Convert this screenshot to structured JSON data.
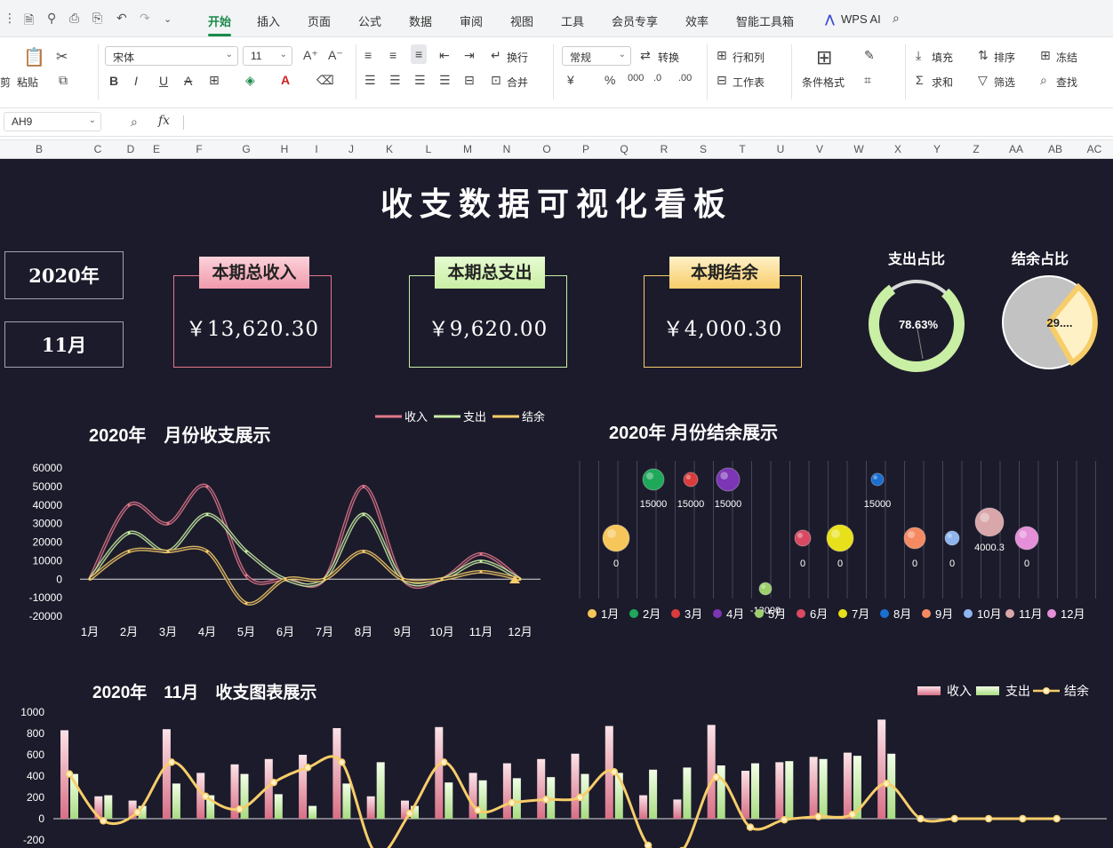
{
  "ribbon_tabs": [
    "开始",
    "插入",
    "页面",
    "公式",
    "数据",
    "审阅",
    "视图",
    "工具",
    "会员专享",
    "效率",
    "智能工具箱"
  ],
  "wps_ai": "WPS AI",
  "ribbon": {
    "paste": "粘贴",
    "font": "宋体",
    "size": "11",
    "wrap": "换行",
    "merge": "合并",
    "format": "常规",
    "convert": "转换",
    "rowcol": "行和列",
    "sheet": "工作表",
    "cond_format": "条件格式",
    "fill": "填充",
    "sort": "排序",
    "freeze": "冻结",
    "sum": "求和",
    "filter": "筛选",
    "find": "查找",
    "cut_label": "剪",
    "bold": "B",
    "italic": "I",
    "underline": "U",
    "strike": "A"
  },
  "namebox": "AH9",
  "fx": "fx",
  "columns": [
    "B",
    "C",
    "D",
    "E",
    "F",
    "G",
    "H",
    "I",
    "J",
    "K",
    "L",
    "M",
    "N",
    "O",
    "P",
    "Q",
    "R",
    "S",
    "T",
    "U",
    "V",
    "W",
    "X",
    "Y",
    "Z",
    "AA",
    "AB",
    "AC"
  ],
  "dashboard": {
    "title": "收支数据可视化看板",
    "year": "2020年",
    "month": "11月",
    "income_label": "本期总收入",
    "income_value": "￥13,620.30",
    "expense_label": "本期总支出",
    "expense_value": "￥9,620.00",
    "balance_label": "本期结余",
    "balance_value": "￥4,000.30",
    "expense_ratio_label": "支出占比",
    "expense_ratio_value": "78.63%",
    "balance_ratio_label": "结余占比",
    "balance_ratio_value": "29....",
    "colors": {
      "income": "#e2788c",
      "expense": "#c9efa4",
      "balance": "#f7cd6a",
      "bg": "#1c1b2b"
    }
  },
  "chart_data": [
    {
      "type": "line",
      "title": "2020年　月份收支展示",
      "categories": [
        "1月",
        "2月",
        "3月",
        "4月",
        "5月",
        "6月",
        "7月",
        "8月",
        "9月",
        "10月",
        "11月",
        "12月"
      ],
      "ylim": [
        -20000,
        60000
      ],
      "yticks": [
        "60000",
        "50000",
        "40000",
        "30000",
        "20000",
        "10000",
        "0",
        "-10000",
        "-20000"
      ],
      "series": [
        {
          "name": "收入",
          "values": [
            0,
            40000,
            30000,
            50000,
            2000,
            0,
            0,
            50000,
            0,
            0,
            13620,
            0
          ]
        },
        {
          "name": "支出",
          "values": [
            0,
            25000,
            15000,
            35000,
            15000,
            0,
            0,
            35000,
            0,
            0,
            9620,
            0
          ]
        },
        {
          "name": "结余",
          "values": [
            0,
            15000,
            15000,
            15000,
            -13000,
            0,
            0,
            15000,
            0,
            0,
            4000,
            0
          ]
        }
      ]
    },
    {
      "type": "scatter",
      "title": "2020年 月份结余展示",
      "categories": [
        "1月",
        "2月",
        "3月",
        "4月",
        "5月",
        "6月",
        "7月",
        "8月",
        "9月",
        "10月",
        "11月",
        "12月"
      ],
      "values": [
        0,
        15000,
        15000,
        15000,
        -13000,
        0,
        0,
        15000,
        0,
        0,
        4000.3,
        0
      ],
      "labels": [
        "0",
        "15000",
        "15000",
        "15000",
        "-13000",
        "0",
        "0",
        "15000",
        "0",
        "0",
        "4000.3",
        "0"
      ],
      "colors": [
        "#f7c65a",
        "#1fa85a",
        "#d83c3c",
        "#7b35b5",
        "#9ccf6b",
        "#d84a62",
        "#e8e01a",
        "#1a6fd0",
        "#f58a62",
        "#8fb5ee",
        "#d9a6aa",
        "#e58fd8"
      ]
    },
    {
      "type": "bar",
      "title": "2020年　11月　收支图表展示",
      "ylim": [
        -200,
        1000
      ],
      "yticks": [
        "1000",
        "800",
        "600",
        "400",
        "200",
        "0",
        "-200"
      ],
      "series": [
        {
          "name": "收入",
          "values": [
            830,
            210,
            170,
            840,
            430,
            510,
            560,
            600,
            850,
            210,
            170,
            860,
            430,
            520,
            560,
            610,
            870,
            220,
            180,
            880,
            450,
            530,
            580,
            620,
            930,
            0,
            0,
            0,
            0,
            0
          ]
        },
        {
          "name": "支出",
          "values": [
            420,
            220,
            120,
            330,
            220,
            420,
            230,
            120,
            330,
            530,
            120,
            340,
            360,
            380,
            390,
            420,
            430,
            460,
            480,
            500,
            520,
            540,
            560,
            590,
            610,
            0,
            0,
            0,
            0,
            0
          ]
        },
        {
          "name": "结余",
          "values": [
            420,
            -20,
            60,
            530,
            210,
            90,
            340,
            480,
            530,
            -320,
            50,
            530,
            80,
            150,
            180,
            200,
            440,
            -250,
            -300,
            390,
            -80,
            -10,
            20,
            40,
            330,
            0,
            0,
            0,
            0,
            0
          ]
        }
      ]
    }
  ]
}
